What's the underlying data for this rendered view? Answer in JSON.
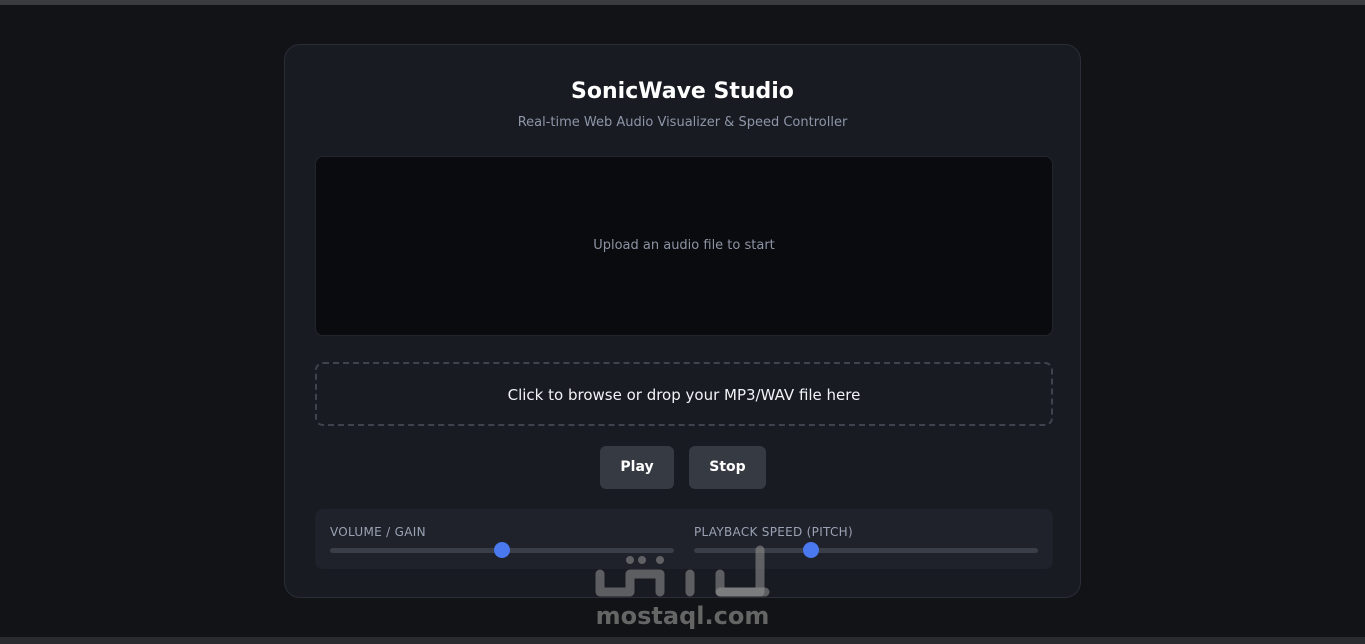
{
  "app": {
    "title": "SonicWave Studio",
    "subtitle": "Real-time Web Audio Visualizer & Speed Controller"
  },
  "visualizer": {
    "message": "Upload an audio file to start"
  },
  "dropzone": {
    "label": "Click to browse or drop your MP3/WAV file here"
  },
  "buttons": {
    "play": "Play",
    "stop": "Stop"
  },
  "controls": {
    "volume": {
      "label": "VOLUME / GAIN",
      "level": 0.5
    },
    "speed": {
      "label": "PLAYBACK SPEED (PITCH)",
      "level": 0.34
    }
  },
  "watermark": {
    "text": "مستقل",
    "url": "mostaql.com"
  },
  "colors": {
    "accent": "#4a78ef",
    "background": "#121316",
    "card": "#181b22"
  }
}
